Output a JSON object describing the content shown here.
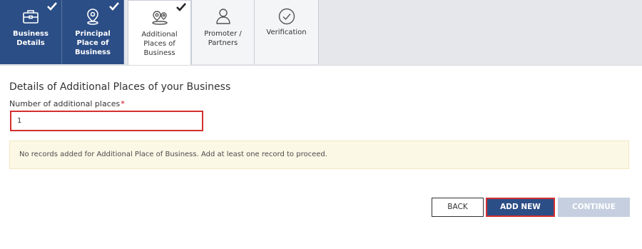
{
  "tabs": [
    {
      "label": "Business\nDetails",
      "icon": "briefcase-icon",
      "state": "completed"
    },
    {
      "label": "Principal\nPlace of\nBusiness",
      "icon": "location-pin-icon",
      "state": "completed"
    },
    {
      "label": "Additional\nPlaces of\nBusiness",
      "icon": "multi-location-icon",
      "state": "active-completed"
    },
    {
      "label": "Promoter /\nPartners",
      "icon": "person-icon",
      "state": "pending"
    },
    {
      "label": "Verification",
      "icon": "check-circle-icon",
      "state": "pending"
    }
  ],
  "form": {
    "section_title": "Details of Additional Places of your Business",
    "number_label": "Number of additional places",
    "required_mark": "*",
    "number_value": "1"
  },
  "notice": "No records added for Additional Place of Business. Add at least one record to proceed.",
  "buttons": {
    "back": "BACK",
    "add_new": "ADD NEW",
    "continue": "CONTINUE"
  },
  "colors": {
    "primary": "#2c4e86",
    "highlight_border": "#d32f2f",
    "notice_bg": "#fcf8e6",
    "disabled": "#c5cfdf"
  }
}
